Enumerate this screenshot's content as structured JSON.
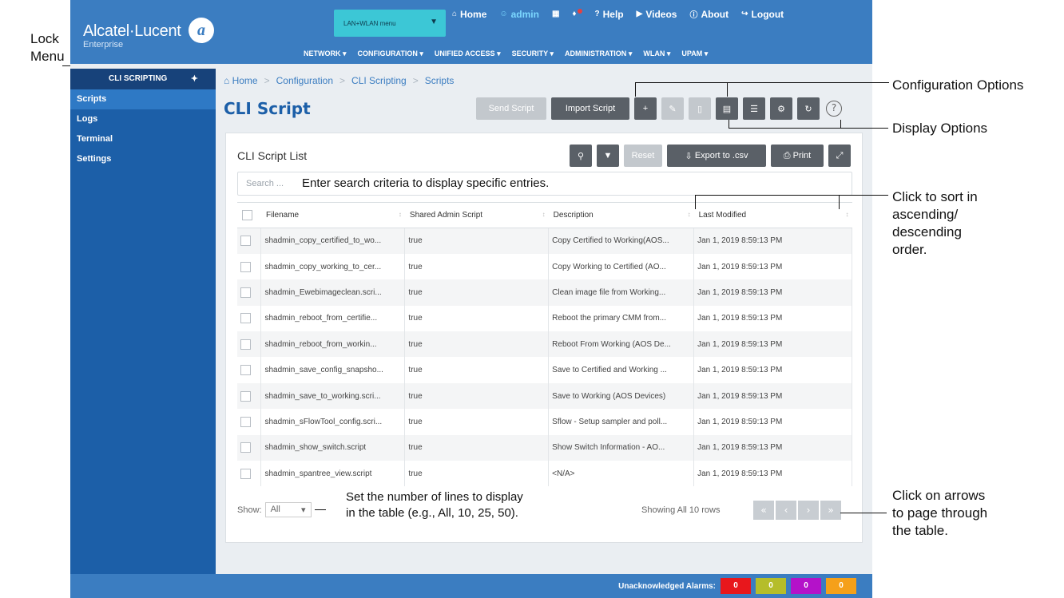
{
  "header": {
    "brand_name": "Alcatel·Lucent",
    "brand_sub": "Enterprise",
    "menu_select": "LAN+WLAN menu",
    "topnav": [
      {
        "icon": "home-icon",
        "glyph": "⌂",
        "label": "Home"
      },
      {
        "icon": "user-icon",
        "glyph": "☺",
        "label": "admin"
      },
      {
        "icon": "grid-icon",
        "glyph": "▦",
        "label": ""
      },
      {
        "icon": "bell-icon",
        "glyph": "␇",
        "label": ""
      },
      {
        "icon": "help-icon",
        "glyph": "?",
        "label": "Help"
      },
      {
        "icon": "video-icon",
        "glyph": "▶",
        "label": "Videos"
      },
      {
        "icon": "info-icon",
        "glyph": "ⓘ",
        "label": "About"
      },
      {
        "icon": "logout-icon",
        "glyph": "↪",
        "label": "Logout"
      }
    ],
    "mainnav": [
      "NETWORK",
      "CONFIGURATION",
      "UNIFIED ACCESS",
      "SECURITY",
      "ADMINISTRATION",
      "WLAN",
      "UPAM"
    ]
  },
  "sidebar": {
    "title": "CLI SCRIPTING",
    "items": [
      {
        "label": "Scripts",
        "active": true
      },
      {
        "label": "Logs"
      },
      {
        "label": "Terminal"
      },
      {
        "label": "Settings"
      }
    ]
  },
  "breadcrumb": [
    "Home",
    "Configuration",
    "CLI Scripting",
    "Scripts"
  ],
  "page": {
    "title": "CLI Script",
    "send_label": "Send Script",
    "import_label": "Import Script"
  },
  "panel": {
    "title": "CLI Script List",
    "reset_label": "Reset",
    "export_label": "Export to .csv",
    "print_label": "Print",
    "search_placeholder": "Search ...",
    "search_hint": "Enter search criteria to display specific entries.",
    "columns": [
      "Filename",
      "Shared Admin Script",
      "Description",
      "Last Modified"
    ],
    "rows": [
      [
        "shadmin_copy_certified_to_wo...",
        "true",
        "Copy Certified to Working(AOS...",
        "Jan 1, 2019 8:59:13 PM"
      ],
      [
        "shadmin_copy_working_to_cer...",
        "true",
        "Copy Working to Certified (AO...",
        "Jan 1, 2019 8:59:13 PM"
      ],
      [
        "shadmin_Ewebimageclean.scri...",
        "true",
        "Clean image file from Working...",
        "Jan 1, 2019 8:59:13 PM"
      ],
      [
        "shadmin_reboot_from_certifie...",
        "true",
        "Reboot the primary CMM from...",
        "Jan 1, 2019 8:59:13 PM"
      ],
      [
        "shadmin_reboot_from_workin...",
        "true",
        "Reboot From Working (AOS De...",
        "Jan 1, 2019 8:59:13 PM"
      ],
      [
        "shadmin_save_config_snapsho...",
        "true",
        "Save to Certified and Working ...",
        "Jan 1, 2019 8:59:13 PM"
      ],
      [
        "shadmin_save_to_working.scri...",
        "true",
        "Save to Working (AOS Devices)",
        "Jan 1, 2019 8:59:13 PM"
      ],
      [
        "shadmin_sFlowTool_config.scri...",
        "true",
        "Sflow - Setup sampler and poll...",
        "Jan 1, 2019 8:59:13 PM"
      ],
      [
        "shadmin_show_switch.script",
        "true",
        "Show Switch Information - AO...",
        "Jan 1, 2019 8:59:13 PM"
      ],
      [
        "shadmin_spantree_view.script",
        "true",
        "<N/A>",
        "Jan 1, 2019 8:59:13 PM"
      ]
    ],
    "show_label": "Show:",
    "show_value": "All",
    "show_hint_1": "Set the number of lines to display",
    "show_hint_2": "in the table (e.g., All, 10, 25, 50).",
    "row_count": "Showing All 10 rows"
  },
  "footer": {
    "alarms_label": "Unacknowledged Alarms:",
    "alarms": [
      {
        "value": "0",
        "color": "#e8171c"
      },
      {
        "value": "0",
        "color": "#b5bd2a"
      },
      {
        "value": "0",
        "color": "#b412c9"
      },
      {
        "value": "0",
        "color": "#f5a01a"
      }
    ]
  },
  "annotations": {
    "lock_menu_1": "Lock",
    "lock_menu_2": "Menu",
    "config_options": "Configuration Options",
    "display_options": "Display Options",
    "sort_1": "Click to sort in",
    "sort_2": "ascending/",
    "sort_3": "descending",
    "sort_4": "order.",
    "page_1": "Click on arrows",
    "page_2": "to page through",
    "page_3": "the table."
  }
}
